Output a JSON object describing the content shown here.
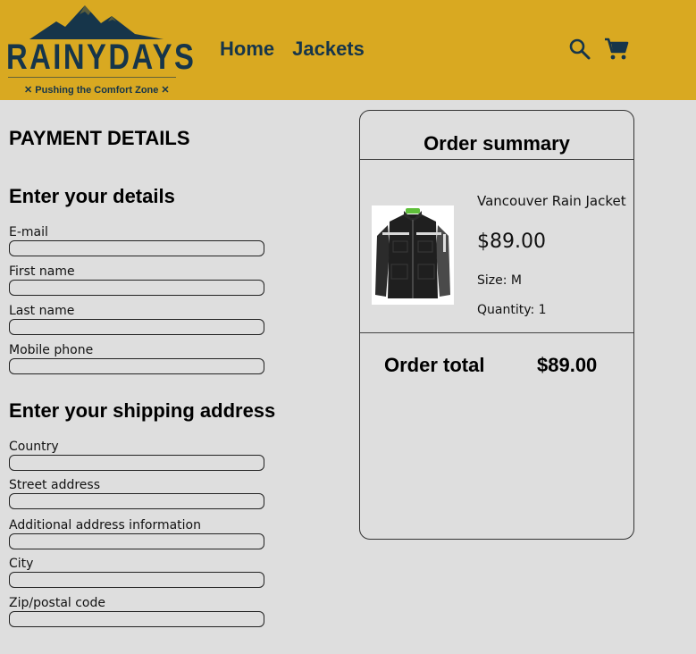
{
  "header": {
    "logo_text": "RAINYDAYS",
    "tagline": "✕ Pushing the Comfort Zone ✕",
    "nav": [
      "Home",
      "Jackets"
    ],
    "icons": [
      "search-icon",
      "cart-icon"
    ],
    "colors": {
      "header_bg": "#d9a921",
      "brand": "#16354a",
      "page_bg": "#dedede"
    }
  },
  "main": {
    "title": "PAYMENT DETAILS",
    "details_heading": "Enter your details",
    "details_fields": [
      {
        "label": "E-mail",
        "value": ""
      },
      {
        "label": "First name",
        "value": ""
      },
      {
        "label": "Last name",
        "value": ""
      },
      {
        "label": "Mobile phone",
        "value": ""
      }
    ],
    "shipping_heading": "Enter your shipping address",
    "shipping_fields": [
      {
        "label": "Country",
        "value": ""
      },
      {
        "label": "Street address",
        "value": ""
      },
      {
        "label": "Additional address information",
        "value": ""
      },
      {
        "label": "City",
        "value": ""
      },
      {
        "label": "Zip/postal code",
        "value": ""
      }
    ]
  },
  "summary": {
    "title": "Order summary",
    "product": {
      "name": "Vancouver Rain Jacket",
      "price": "$89.00",
      "size": "Size: M",
      "quantity": "Quantity: 1"
    },
    "total_label": "Order total",
    "total_value": "$89.00"
  }
}
